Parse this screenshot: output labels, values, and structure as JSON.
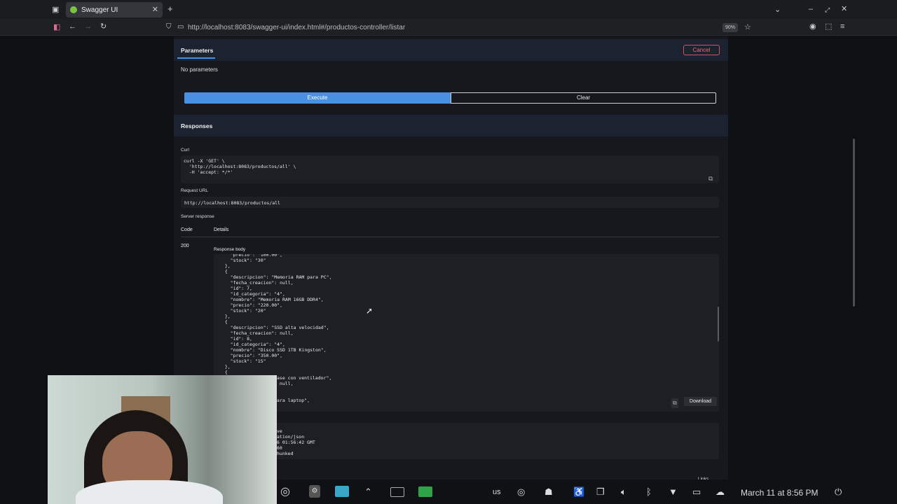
{
  "browser": {
    "tab_title": "Swagger UI",
    "url": "http://localhost:8083/swagger-ui/index.html#/productos-controller/listar",
    "zoom": "90%"
  },
  "parameters": {
    "title": "Parameters",
    "cancel_label": "Cancel",
    "empty_text": "No parameters"
  },
  "actions": {
    "execute_label": "Execute",
    "clear_label": "Clear"
  },
  "responses": {
    "title": "Responses",
    "curl_label": "Curl",
    "curl_code": "curl -X 'GET' \\\n  'http://localhost:8083/productos/all' \\\n  -H 'accept: */*'",
    "request_url_label": "Request URL",
    "request_url": "http://localhost:8083/productos/all",
    "server_response_label": "Server response",
    "code_header": "Code",
    "details_header": "Details",
    "code_value": "200",
    "response_body_label": "Response body",
    "response_body": "    \"precio\": \"100.00\",\n    \"stock\": \"30\"\n  },\n  {\n    \"descripcion\": \"Memoria RAM para PC\",\n    \"fecha_creacion\": null,\n    \"id\": 7,\n    \"id_categoria\": \"4\",\n    \"nombre\": \"Memoria RAM 16GB DDR4\",\n    \"precio\": \"220.00\",\n    \"stock\": \"20\"\n  },\n  {\n    \"descripcion\": \"SSD alta velocidad\",\n    \"fecha_creacion\": null,\n    \"id\": 8,\n    \"id_categoria\": \"4\",\n    \"nombre\": \"Disco SSD 1TB Kingston\",\n    \"precio\": \"350.00\",\n    \"stock\": \"15\"\n  },\n  {",
    "response_body_tail": "ase con ventilador\",\n null,\n\n\nara laptop\",",
    "download_label": "Download",
    "headers_tail": "ve\nation/json\n6 01:56:42 GMT\n60\nhunked",
    "links_label": "Links"
  },
  "taskbar": {
    "keyboard_layout": "us",
    "datetime": "March 11 at 8:56 PM"
  }
}
